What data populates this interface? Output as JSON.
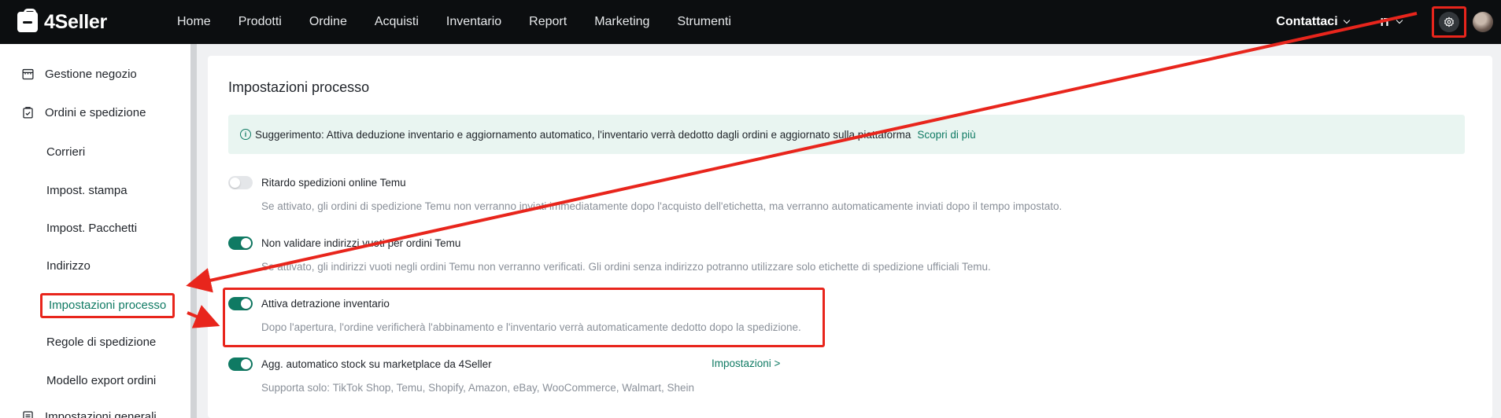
{
  "app": {
    "brand": "4Seller"
  },
  "nav": {
    "items": [
      "Home",
      "Prodotti",
      "Ordine",
      "Acquisti",
      "Inventario",
      "Report",
      "Marketing",
      "Strumenti"
    ]
  },
  "header": {
    "contact": "Contattaci",
    "language": "IT"
  },
  "sidebar": {
    "group1": "Gestione negozio",
    "group2": "Ordini e spedizione",
    "items": [
      "Corrieri",
      "Impost. stampa",
      "Impost. Pacchetti",
      "Indirizzo",
      "Impostazioni processo",
      "Regole di spedizione",
      "Modello export ordini"
    ],
    "group3": "Impostazioni generali"
  },
  "page": {
    "title": "Impostazioni processo",
    "tip": {
      "text": "Suggerimento: Attiva deduzione inventario e aggiornamento automatico, l'inventario verrà dedotto dagli ordini e aggiornato sulla piattaforma",
      "link": "Scopri di più"
    },
    "settings": [
      {
        "label": "Ritardo spedizioni online Temu",
        "desc": "Se attivato, gli ordini di spedizione Temu non verranno inviati immediatamente dopo l'acquisto dell'etichetta, ma verranno automaticamente inviati dopo il tempo impostato.",
        "on": false
      },
      {
        "label": "Non validare indirizzi vuoti per ordini Temu",
        "desc": "Se attivato, gli indirizzi vuoti negli ordini Temu non verranno verificati. Gli ordini senza indirizzo potranno utilizzare solo etichette di spedizione ufficiali Temu.",
        "on": true
      },
      {
        "label": "Attiva detrazione inventario",
        "desc": "Dopo l'apertura, l'ordine verificherà l'abbinamento e l'inventario verrà automaticamente dedotto dopo la spedizione.",
        "on": true
      },
      {
        "label": "Agg. automatico stock su marketplace da 4Seller",
        "desc": "Supporta solo: TikTok Shop, Temu, Shopify, Amazon, eBay, WooCommerce, Walmart, Shein",
        "on": true,
        "link": "Impostazioni >"
      }
    ]
  },
  "colors": {
    "accent": "#0f7a63",
    "annotation": "#e8251c",
    "topbar": "#0c0e10"
  }
}
